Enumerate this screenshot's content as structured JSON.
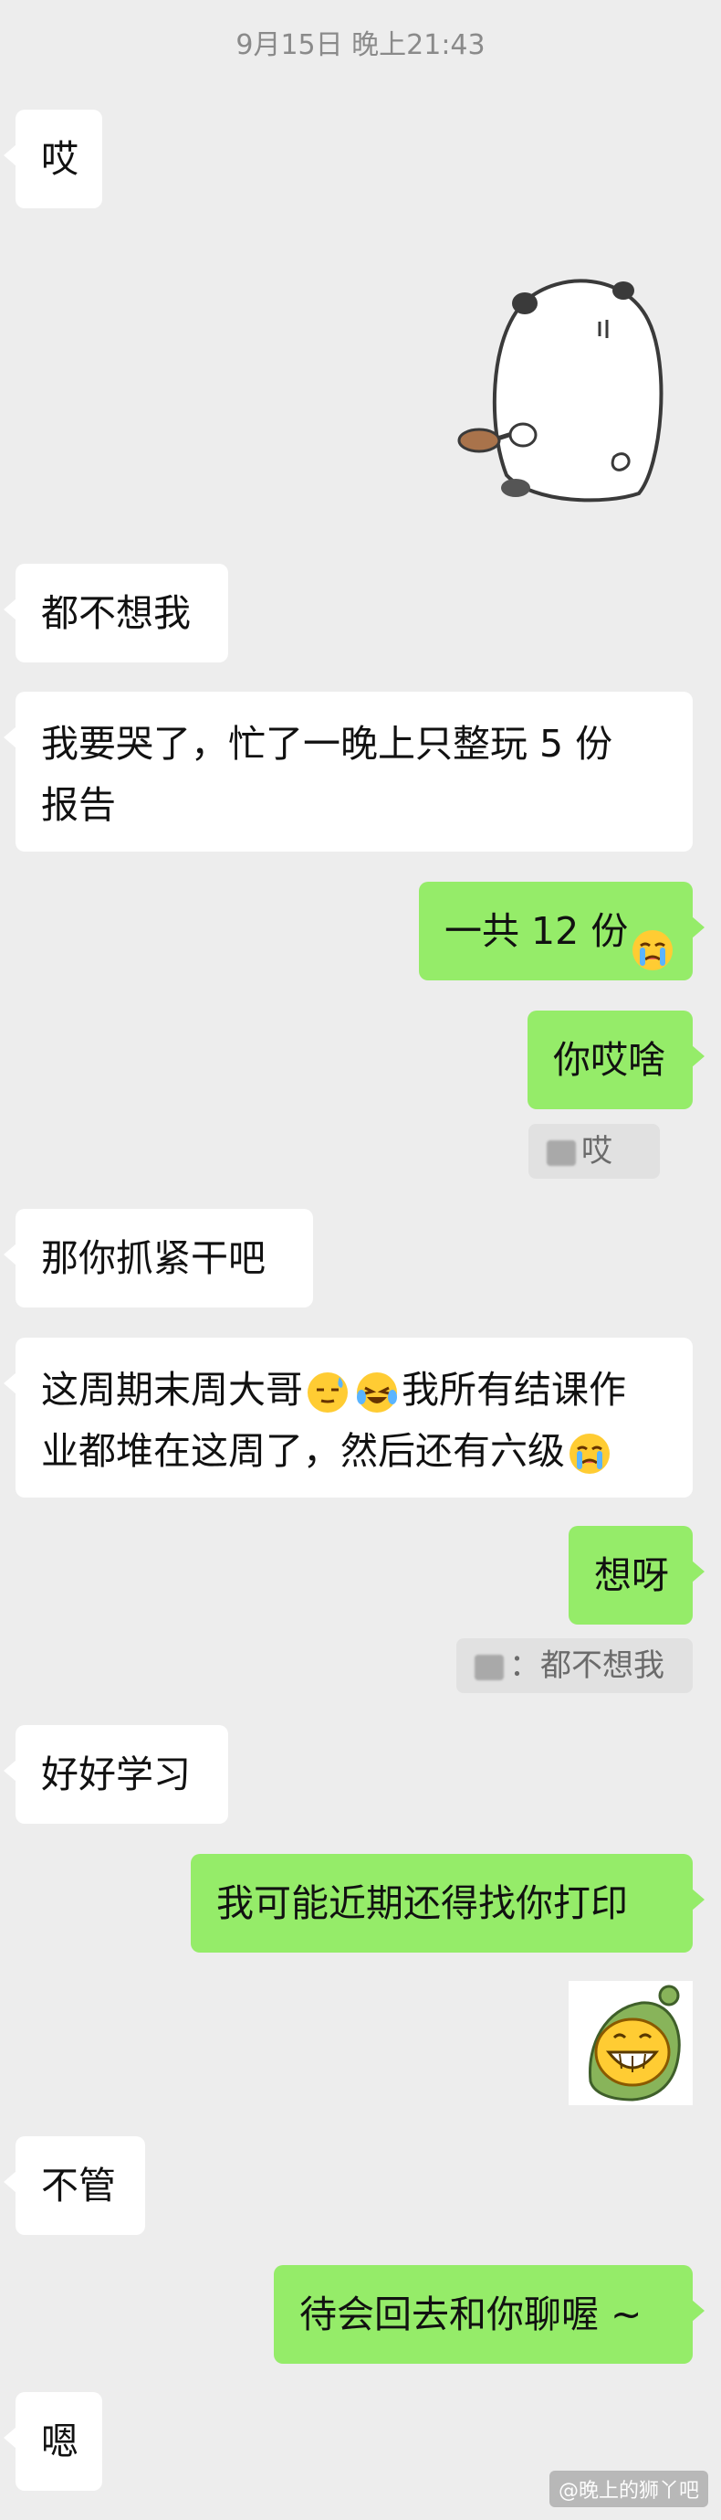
{
  "timestamp": "9月15日 晚上21:43",
  "messages": {
    "m1": "哎",
    "m2": "都不想我",
    "m3_line1": "我要哭了，忙了一晚上只整玩 5 份",
    "m3_line2": "报告",
    "m4": "一共 12 份",
    "m5": "你哎啥",
    "q1": "哎",
    "m6": "那你抓紧干吧",
    "m7_part1": "这周期末周大哥",
    "m7_part2": "我所有结课作",
    "m7_line2": "业都堆在这周了，然后还有六级",
    "m8": "想呀",
    "q2": "：都不想我",
    "m9": "好好学习",
    "m10": "我可能近期还得找你打印",
    "m11": "不管",
    "m12": "待会回去和你聊喔 ~",
    "m13": "嗯"
  },
  "stickers": {
    "s1": "panda-sticker",
    "s2": "grinning-character-sticker"
  },
  "emoji_names": [
    "loudly-crying-emoji",
    "sweat-smile-emoji",
    "laughing-crying-emoji"
  ],
  "colors": {
    "background": "#ededed",
    "sent_bubble": "#95ec69",
    "received_bubble": "#ffffff",
    "quote_bg": "#e1e1e1"
  },
  "watermark": "@晚上的狮丫吧"
}
